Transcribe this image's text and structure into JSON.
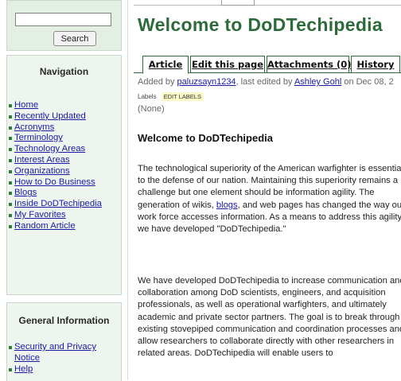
{
  "search": {
    "placeholder": "",
    "value": "",
    "button_label": "Search"
  },
  "navigation": {
    "heading": "Navigation",
    "items": [
      "Home",
      "Recently Updated",
      "Acronyms",
      "Terminology",
      "Technology Areas",
      "Interest Areas",
      "Organizations",
      "How to Do Business",
      "Blogs",
      "Inside DoDTechipedia",
      "My Favorites",
      "Random Article"
    ]
  },
  "general_info": {
    "heading": "General Information",
    "items": [
      "Security and Privacy Notice",
      "Help"
    ]
  },
  "page": {
    "title": "Welcome to DoDTechipedia",
    "tabs": {
      "article": "Article",
      "edit": "Edit this page",
      "attachments": "Attachments (0)",
      "history": "History"
    },
    "meta": {
      "added_by_text": "Added by ",
      "author": "paluzsayn1234",
      "edited_text": ", last edited by ",
      "editor": "Ashley Gohl",
      "date_text": " on Dec 08, 2"
    },
    "labels_label": "Labels",
    "edit_labels": "EDIT LABELS",
    "labels_value": "(None)",
    "section_heading": "Welcome to DoDTechipedia",
    "para1_a": "The technological superiority of the American warfighter is essential to the defense of our nation. Maintaining this superiority remains a challenge but one element should be information agility. The generation of wikis, ",
    "para1_link": "blogs",
    "para1_b": ", and web pages has changed the way our work force accesses information. As a means to address this agility, we have developed \"DoDTechipedia.\"",
    "para2": "We have developed DoDTechipedia to increase communication and collaboration among DoD scientists, engineers, and acquisition professionals, as well as operational warfighters, and ultimately academic and private sector partners. The goal is to break through existing stovepiped communication and coordination processes and allow researchers to collaborate directly with other researchers in related areas. DoDTechipedia will enable users to"
  },
  "colors": {
    "accent_green": "#2e6b3a",
    "link_blue": "#1a1aa6",
    "sidebar_bg": "#eef5ee"
  }
}
